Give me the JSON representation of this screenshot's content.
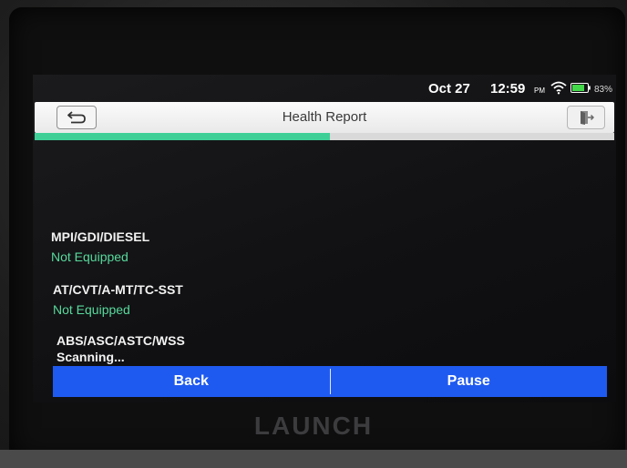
{
  "status_bar": {
    "date": "Oct 27",
    "time": "12:59",
    "ampm": "PM",
    "battery": "83%"
  },
  "header": {
    "title": "Health Report",
    "back_icon": "return-arrow-icon",
    "exit_icon": "exit-door-icon"
  },
  "progress": {
    "fraction": 0.51,
    "color": "#3ecf97"
  },
  "systems": [
    {
      "name": "MPI/GDI/DIESEL",
      "status": "Not Equipped",
      "status_color": "green"
    },
    {
      "name": "AT/CVT/A-MT/TC-SST",
      "status": "Not Equipped",
      "status_color": "green"
    },
    {
      "name": "ABS/ASC/ASTC/WSS",
      "status": "Scanning...",
      "status_color": "white"
    }
  ],
  "actions": {
    "back_label": "Back",
    "pause_label": "Pause"
  },
  "device": {
    "brand": "LAUNCH"
  },
  "colors": {
    "action_bar": "#1f5af0",
    "title_bar": "#f3f3f3",
    "screen": "#111113"
  }
}
